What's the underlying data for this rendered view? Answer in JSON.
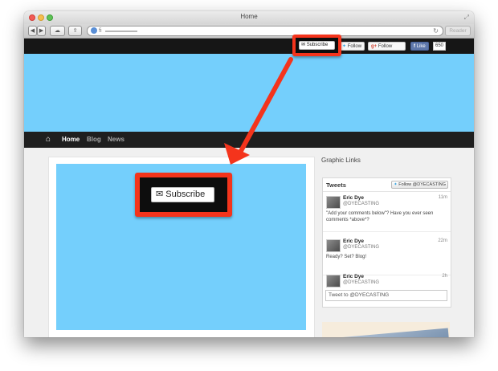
{
  "window": {
    "title": "Home",
    "reader_label": "Reader",
    "url_text": "fi"
  },
  "top_bar": {
    "subscribe_label": "Subscribe",
    "twitter_follow_label": "Follow",
    "gplus_follow_label": "Follow",
    "fb_like_label": "Like",
    "fb_like_count": "650"
  },
  "nav": {
    "items": [
      {
        "label": "Home",
        "active": true
      },
      {
        "label": "Blog",
        "active": false
      },
      {
        "label": "News",
        "active": false
      }
    ]
  },
  "main": {
    "subscribe_label": "Subscribe"
  },
  "sidebar": {
    "heading": "Graphic Links",
    "tweets": {
      "title": "Tweets",
      "follow_label": "Follow @DYECASTING",
      "items": [
        {
          "name": "Eric Dye",
          "handle": "@DYECASTING",
          "time": "11m",
          "text": "\"Add your comments below\"? Have you ever seen comments *above*?"
        },
        {
          "name": "Eric Dye",
          "handle": "@DYECASTING",
          "time": "22m",
          "text": "Ready? Set? Blog!"
        },
        {
          "name": "Eric Dye",
          "handle": "@DYECASTING",
          "time": "2h",
          "text": ""
        }
      ],
      "tweet_box_placeholder": "Tweet to @DYECASTING"
    }
  },
  "colors": {
    "accent_red": "#f4341c",
    "hero_blue": "#74cffc",
    "bar_dark": "#161616"
  },
  "icons": [
    "envelope-icon",
    "twitter-bird-icon",
    "google-plus-icon",
    "facebook-icon",
    "home-icon",
    "refresh-icon",
    "globe-icon",
    "callout-arrow"
  ]
}
